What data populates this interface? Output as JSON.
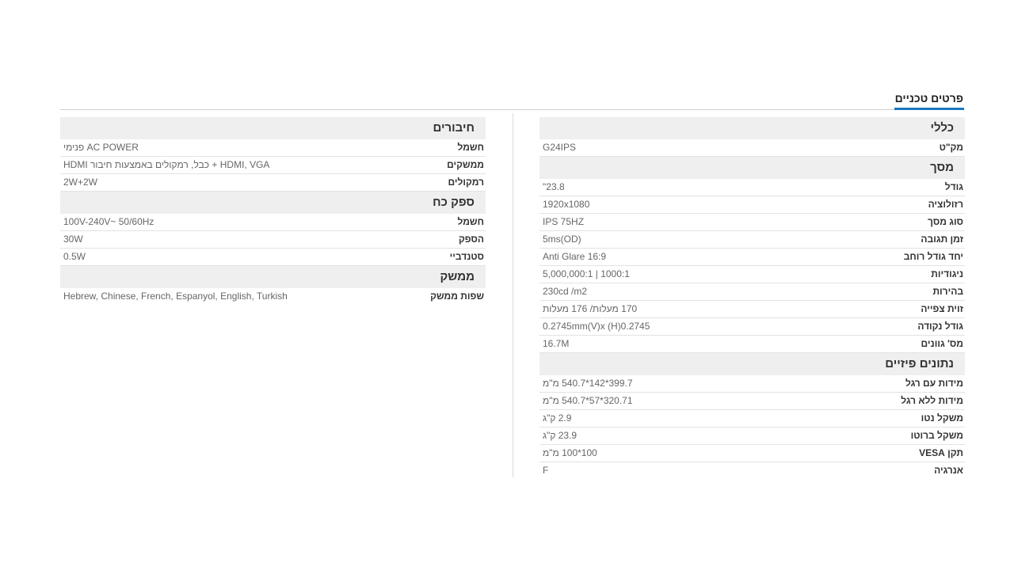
{
  "tab": {
    "label": "פרטים טכניים",
    "accent": "#1a78c2"
  },
  "right_column": [
    {
      "title": "כללי",
      "rows": [
        {
          "label": "מק\"ט",
          "value": "G24IPS"
        }
      ]
    },
    {
      "title": "מסך",
      "rows": [
        {
          "label": "גודל",
          "value": "23.8\""
        },
        {
          "label": "רזולוציה",
          "value": "1920x1080"
        },
        {
          "label": "סוג מסך",
          "value": "IPS 75HZ"
        },
        {
          "label": "זמן תגובה",
          "value": "5ms(OD)"
        },
        {
          "label": "יחד גודל רוחב",
          "value": "Anti Glare 16:9"
        },
        {
          "label": "ניגודיות",
          "value": "1000:1 | 5,000,000:1"
        },
        {
          "label": "בהירות",
          "value": "230cd /m2"
        },
        {
          "label": "זוית צפייה",
          "value": "170 מעלות/ 176 מעלות"
        },
        {
          "label": "גודל נקודה",
          "value": "0.2745mm(V)x (H)0.2745"
        },
        {
          "label": "מס' גוונים",
          "value": "16.7M"
        }
      ]
    },
    {
      "title": "נתונים פיזיים",
      "rows": [
        {
          "label": "מידות עם רגל",
          "value": "399.7*142*540.7 מ\"מ"
        },
        {
          "label": "מידות ללא רגל",
          "value": "320.71*57*540.7 מ\"מ"
        },
        {
          "label": "משקל נטו",
          "value": "2.9 ק\"ג"
        },
        {
          "label": "משקל ברוטו",
          "value": "23.9 ק\"ג"
        },
        {
          "label": "תקן VESA",
          "value": "100*100 מ\"מ"
        },
        {
          "label": "אנרגיה",
          "value": "F"
        }
      ]
    }
  ],
  "left_column": [
    {
      "title": "חיבורים",
      "rows": [
        {
          "label": "חשמל",
          "value": "AC POWER פנימי"
        },
        {
          "label": "ממשקים",
          "value": "HDMI, VGA + כבל, רמקולים באמצעות חיבור HDMI"
        },
        {
          "label": "רמקולים",
          "value": "2W+2W"
        }
      ]
    },
    {
      "title": "ספק כח",
      "rows": [
        {
          "label": "חשמל",
          "value": "100V-240V~ 50/60Hz"
        },
        {
          "label": "הספק",
          "value": "30W"
        },
        {
          "label": "סטנדביי",
          "value": "0.5W"
        }
      ]
    },
    {
      "title": "ממשק",
      "rows": [
        {
          "label": "שפות ממשק",
          "value": "Hebrew, Chinese, French, Espanyol, English, Turkish"
        }
      ]
    }
  ]
}
